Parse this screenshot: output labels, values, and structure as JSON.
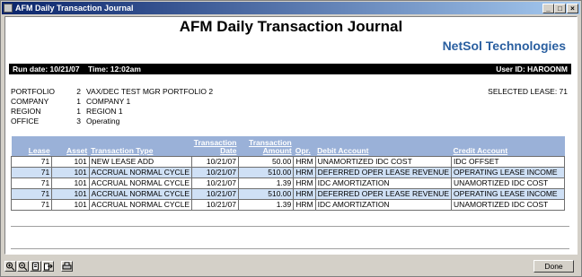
{
  "window": {
    "title": "AFM Daily Transaction Journal"
  },
  "report": {
    "title": "AFM Daily Transaction Journal",
    "company_logo": "NetSol Technologies",
    "run_date": "Run date: 10/21/07",
    "time": "Time: 12:02am",
    "user_id": "User ID: HAROONM"
  },
  "info": {
    "portfolio": {
      "label": "PORTFOLIO",
      "num": "2",
      "value": "VAX/DEC TEST MGR PORTFOLIO 2"
    },
    "company": {
      "label": "COMPANY",
      "num": "1",
      "value": "COMPANY 1"
    },
    "region": {
      "label": "REGION",
      "num": "1",
      "value": "REGION 1"
    },
    "office": {
      "label": "OFFICE",
      "num": "3",
      "value": "Operating"
    },
    "selected_lease": "SELECTED LEASE: 71"
  },
  "table": {
    "headers": [
      "Lease",
      "Asset",
      "Transaction Type",
      "Transaction Date",
      "Transaction Amount",
      "Opr.",
      "Debit Account",
      "Credit Account"
    ],
    "rows": [
      [
        "71",
        "101",
        "NEW LEASE ADD",
        "10/21/07",
        "50.00",
        "HRM",
        "UNAMORTIZED IDC COST",
        "IDC OFFSET"
      ],
      [
        "71",
        "101",
        "ACCRUAL NORMAL CYCLE",
        "10/21/07",
        "510.00",
        "HRM",
        "DEFERRED OPER LEASE REVENUE",
        "OPERATING LEASE INCOME"
      ],
      [
        "71",
        "101",
        "ACCRUAL NORMAL CYCLE",
        "10/21/07",
        "1.39",
        "HRM",
        "IDC AMORTIZATION",
        "UNAMORTIZED IDC COST"
      ],
      [
        "71",
        "101",
        "ACCRUAL NORMAL CYCLE",
        "10/21/07",
        "510.00",
        "HRM",
        "DEFERRED OPER LEASE REVENUE",
        "OPERATING LEASE INCOME"
      ],
      [
        "71",
        "101",
        "ACCRUAL NORMAL CYCLE",
        "10/21/07",
        "1.39",
        "HRM",
        "IDC AMORTIZATION",
        "UNAMORTIZED IDC COST"
      ]
    ]
  },
  "buttons": {
    "done": "Done",
    "minimize": "_",
    "maximize": "□",
    "close": "×"
  },
  "toolbar_icons": [
    "zoom-in-icon",
    "zoom-out-icon",
    "page-icon",
    "export-icon",
    "print-icon"
  ],
  "colors": {
    "header_bg": "#9ab1d8",
    "alt_row": "#cfe0f5",
    "logo": "#2a5fa0"
  }
}
